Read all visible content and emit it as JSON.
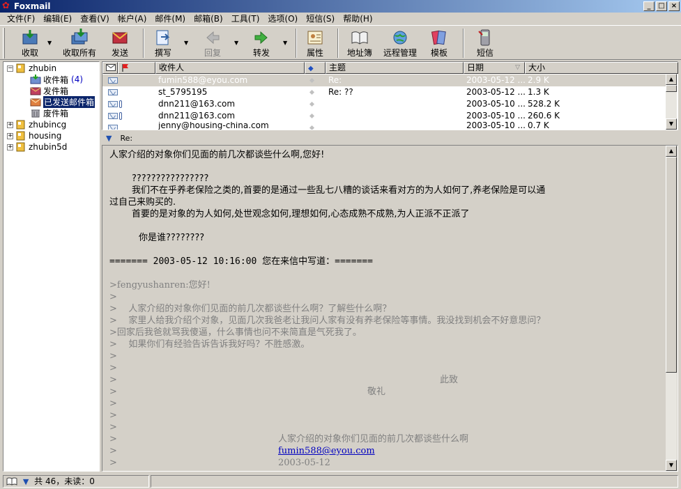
{
  "window": {
    "title": "Foxmail"
  },
  "menu": [
    "文件(F)",
    "编辑(E)",
    "查看(V)",
    "帐户(A)",
    "邮件(M)",
    "邮箱(B)",
    "工具(T)",
    "选项(O)",
    "短信(S)",
    "帮助(H)"
  ],
  "toolbar": {
    "receive": "收取",
    "receive_all": "收取所有",
    "send": "发送",
    "compose": "撰写",
    "reply": "回复",
    "forward": "转发",
    "properties": "属性",
    "address_book": "地址簿",
    "remote_manage": "远程管理",
    "templates": "模板",
    "sms": "短信"
  },
  "tree": {
    "accounts": [
      {
        "name": "zhubin",
        "expander": "−"
      },
      {
        "name": "zhubincg",
        "expander": "+"
      },
      {
        "name": "housing",
        "expander": "+"
      },
      {
        "name": "zhubin5d",
        "expander": "+"
      }
    ],
    "folders": [
      {
        "name": "收件箱",
        "count": "(4)"
      },
      {
        "name": "发件箱"
      },
      {
        "name": "已发送邮件箱"
      },
      {
        "name": "废件箱"
      }
    ]
  },
  "list": {
    "columns": {
      "recipient": "收件人",
      "subject": "主题",
      "date": "日期",
      "size": "大小"
    },
    "rows": [
      {
        "recipient": "fumin588@eyou.com",
        "subject": "Re:",
        "date": "2003-05-12 ...",
        "size": "2.9 K"
      },
      {
        "recipient": "st_5795195",
        "subject": "Re: ??",
        "date": "2003-05-12 ...",
        "size": "1.3 K"
      },
      {
        "recipient": "dnn211@163.com",
        "subject": "",
        "date": "2003-05-10 ...",
        "size": "528.2 K"
      },
      {
        "recipient": "dnn211@163.com",
        "subject": "",
        "date": "2003-05-10 ...",
        "size": "260.6 K"
      },
      {
        "recipient": "jenny@housing-china.com",
        "subject": "",
        "date": "2003-05-10 ...",
        "size": "0.7 K"
      }
    ]
  },
  "preview": {
    "subject": "Re:",
    "lines": [
      "人家介绍的对象你们见面的前几次都谈些什么啊,您好!",
      "????????????????",
      "我们不在乎养老保险之类的,首要的是通过一些乱七八糟的谈话来看对方的为人如何了,养老保险是可以通",
      "过自己来购买的.",
      "首要的是对象的为人如何,处世观念如何,理想如何,心态成熟不成熟,为人正派不正派了",
      "你是谁????????",
      "======= 2003-05-12 10:16:00 您在来信中写道：=======",
      ">fengyushanren:您好!",
      ">",
      ">    人家介绍的对象你们见面的前几次都谈些什么啊？了解些什么啊？",
      ">    家里人给我介绍个对象，见面几次我爸老让我问人家有没有养老保险等事情。我没找到机会不好意思问？",
      ">回家后我爸就骂我傻逼，什么事情也问不来简直是气死我了。",
      ">    如果你们有经验告诉告诉我好吗？不胜感激。",
      ">",
      ">",
      ">",
      "此致",
      ">",
      "敬礼",
      ">",
      ">",
      ">",
      ">",
      "人家介绍的对象你们见面的前几次都谈些什么啊",
      ">",
      "fumin588@eyou.com",
      ">",
      "2003-05-12"
    ]
  },
  "status": {
    "summary": "共 46，未读：0"
  }
}
